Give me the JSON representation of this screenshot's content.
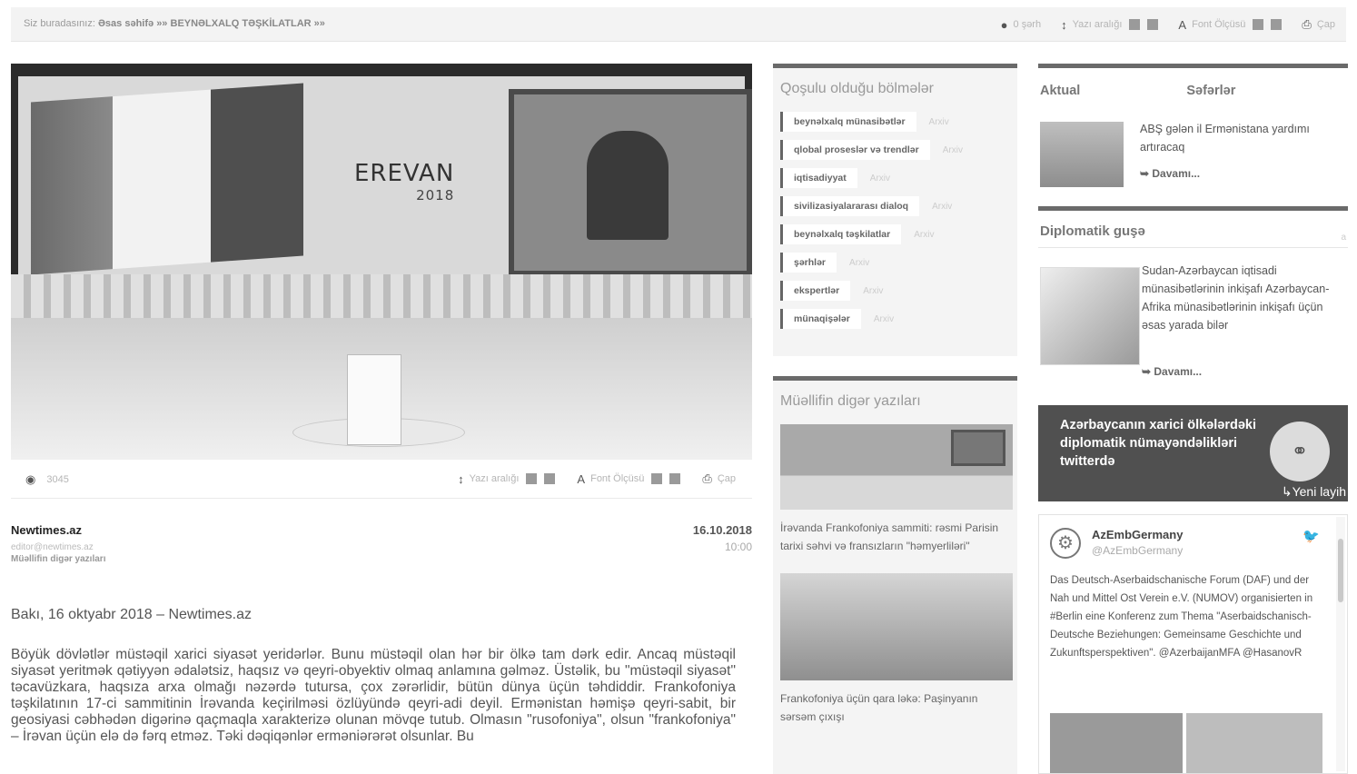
{
  "breadcrumb": {
    "prefix": "Siz buradasınız:",
    "home": "Əsas səhifə",
    "sep1": "»»",
    "section": "BEYNƏLXALQ TƏŞKİLATLAR",
    "sep2": "»»"
  },
  "toolbar": {
    "comments_label": "0 şərh",
    "line_spacing_label": "Yazı aralığı",
    "font_size_label": "Font Ölçüsü",
    "print_label": "Çap"
  },
  "hero": {
    "logo_text": "EREVAN",
    "logo_year": "2018"
  },
  "article_meta": {
    "views": "3045",
    "line_spacing_label": "Yazı aralığı",
    "font_size_label": "Font Ölçüsü",
    "print_label": "Çap"
  },
  "author": {
    "name": "Newtimes.az",
    "email": "editor@newtimes.az",
    "other_posts": "Müəllifin digər yazıları"
  },
  "date": {
    "day": "16.10.2018",
    "time": "10:00"
  },
  "article": {
    "lead": "Bakı, 16 oktyabr 2018 – Newtimes.az",
    "body": "Böyük dövlətlər müstəqil xarici siyasət yeridərlər. Bunu müstəqil olan hər bir ölkə tam dərk edir. Ancaq müstəqil siyasət yeritmək qətiyyən ədalətsiz, haqsız və qeyri-obyektiv olmaq anlamına gəlməz. Üstəlik, bu \"müstəqil siyasət\" təcavüzkara, haqsıza arxa olmağı nəzərdə tutursa, çox zərərlidir, bütün dünya üçün təhdiddir. Frankofoniya təşkilatının 17-ci sammitinin İrəvanda keçirilməsi özlüyündə qeyri-adi deyil. Ermənistan həmişə qeyri-sabit, bir geosiyasi cəbhədən digərinə qaçmaqla xarakterizə olunan mövqe tutub. Olmasın \"rusofoniya\", olsun \"frankofoniya\" – İrəvan üçün elə də fərq etməz. Təki dəqiqənlər erməniərərət olsunlar. Bu"
  },
  "related_sections": {
    "title": "Qoşulu olduğu bölmələr",
    "archive_label": "Arxiv",
    "items": [
      "beynəlxalq münasibətlər",
      "qlobal proseslər və trendlər",
      "iqtisadiyyat",
      "sivilizasiyalararası dialoq",
      "beynəlxalq təşkilatlar",
      "şərhlər",
      "ekspertlər",
      "münaqişələr"
    ]
  },
  "author_posts": {
    "title": "Müəllifin digər yazıları",
    "items": [
      "İrəvanda Frankofoniya sammiti: rəsmi Parisin tarixi səhvi və fransızların \"həmyerliləri\"",
      "Frankofoniya üçün qara ləkə: Paşinyanın sərsəm çıxışı"
    ]
  },
  "right_tabs": {
    "tab1": "Aktual",
    "tab2": "Səfərlər"
  },
  "news1": {
    "title": "ABŞ gələn il Ermənistana yardımı artıracaq",
    "more": "Davamı..."
  },
  "diplomatic": {
    "title": "Diplomatik guşə",
    "archive": "a",
    "news": "Sudan-Azərbaycan iqtisadi münasibətlərinin inkişafı Azərbaycan-Afrika münasibətlərinin inkişafı üçün əsas yarada bilər",
    "more": "Davamı..."
  },
  "banner": {
    "text": "Azərbaycanın xarici ölkələrdəki diplomatik nümayəndəlikləri twitterdə",
    "new_label": "↳Yeni layih"
  },
  "tweet": {
    "name": "AzEmbGermany",
    "handle": "@AzEmbGermany",
    "text": "Das Deutsch-Aserbaidschanische Forum (DAF) und der Nah und Mittel Ost Verein e.V. (NUMOV) organisierten in #Berlin eine Konferenz zum Thema \"Aserbaidschanisch-Deutsche Beziehungen: Gemeinsame Geschichte und Zukunftsperspektiven\". @AzerbaijanMFA @HasanovR"
  }
}
